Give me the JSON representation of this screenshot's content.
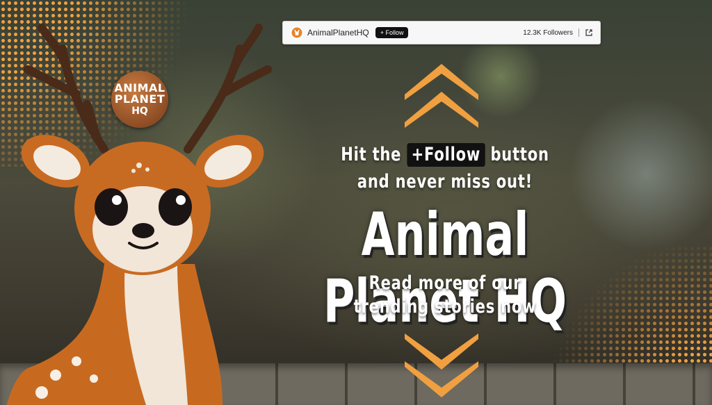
{
  "header": {
    "account_name": "AnimalPlanetHQ",
    "follow_label": "+ Follow",
    "followers": "12.3K Followers",
    "logo_icon": "deer-logo-icon",
    "external_icon": "external-link-icon"
  },
  "badge": {
    "line1": "ANIMAL",
    "line2": "PLANET",
    "line3": "HQ"
  },
  "promo": {
    "hit_text": "Hit the",
    "follow_pill": "+Follow",
    "button_text": "button",
    "line2": "and never miss out!",
    "title": "Animal Planet HQ",
    "line4": "Read more of our",
    "line5": "trending stories now"
  },
  "colors": {
    "accent": "#f0a040",
    "dark": "#111111",
    "text": "#ffffff"
  },
  "icons": [
    "chevron-up-icon",
    "chevron-down-icon"
  ]
}
